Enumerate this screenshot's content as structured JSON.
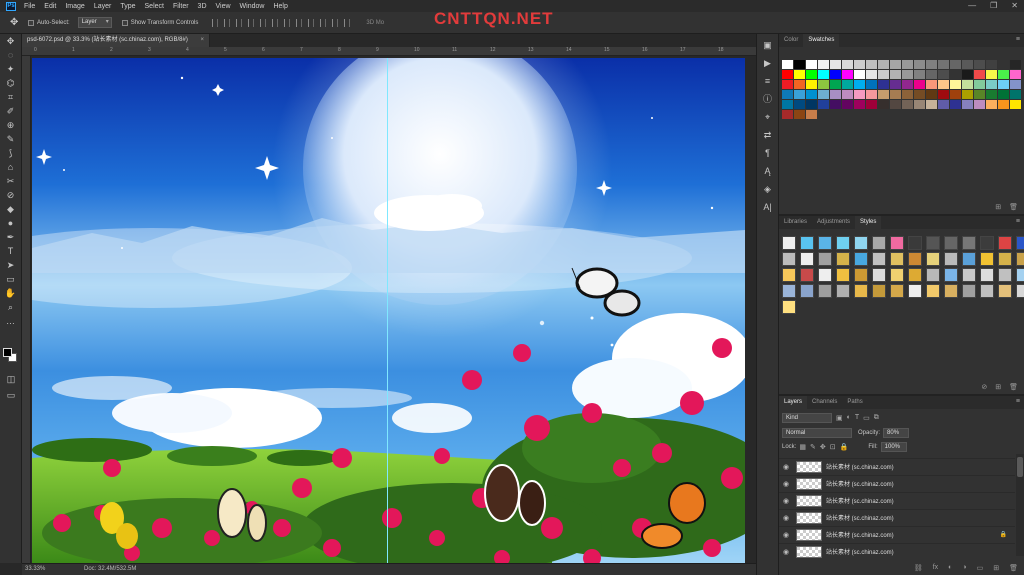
{
  "app": {
    "logo": "Ps"
  },
  "menu": [
    "File",
    "Edit",
    "Image",
    "Layer",
    "Type",
    "Select",
    "Filter",
    "3D",
    "View",
    "Window",
    "Help"
  ],
  "window_controls": [
    "—",
    "❐",
    "✕"
  ],
  "watermark": "CNTTQN.NET",
  "options": {
    "auto_select_label": "Auto-Select:",
    "auto_select_value": "Layer",
    "show_transform_label": "Show Transform Controls",
    "mode_3d": "3D Mo"
  },
  "document": {
    "tab_title": "psd-6072.psd @ 33.3% (站长素材 (sc.chinaz.com), RGB/8#)",
    "close": "×",
    "ruler_numbers": [
      "0",
      "1",
      "2",
      "3",
      "4",
      "5",
      "6",
      "7",
      "8",
      "9",
      "10",
      "11",
      "12",
      "13",
      "14",
      "15",
      "16",
      "17",
      "18"
    ]
  },
  "status": {
    "zoom": "33.33%",
    "doc": "Doc: 32.4M/532.5M"
  },
  "tools": [
    "✥",
    "◌",
    "✦",
    "⌬",
    "⌗",
    "✐",
    "⊕",
    "✎",
    "⟆",
    "⌂",
    "✂",
    "⊘",
    "◆",
    "●",
    "✒",
    "T",
    "➤",
    "▭",
    "✋",
    "⌕",
    "…"
  ],
  "dock_icons": [
    "▣",
    "▶",
    "≡",
    "ⓘ",
    "⌖",
    "⇄",
    "¶",
    "Ą",
    "◈",
    "A|"
  ],
  "color_panel": {
    "tabs": [
      "Color",
      "Swatches"
    ],
    "active_tab": "Swatches",
    "swatches": [
      "#ffffff",
      "#000000",
      "#ffffff",
      "#f2f2f2",
      "#e6e6e6",
      "#d9d9d9",
      "#cccccc",
      "#bfbfbf",
      "#b3b3b3",
      "#a6a6a6",
      "#999999",
      "#8c8c8c",
      "#808080",
      "#737373",
      "#666666",
      "#595959",
      "#4d4d4d",
      "#404040",
      "#333333",
      "#262626",
      "#ff0000",
      "#ffff00",
      "#00ff00",
      "#00ffff",
      "#0000ff",
      "#ff00ff",
      "#ffffff",
      "#e6e6e6",
      "#cccccc",
      "#b3b3b3",
      "#999999",
      "#808080",
      "#666666",
      "#4d4d4d",
      "#333333",
      "#1a1a1a",
      "#f04a4a",
      "#f7f74a",
      "#4af04a",
      "#ff66cc",
      "#ed1c24",
      "#f26522",
      "#fff200",
      "#8dc63f",
      "#00a651",
      "#00a99d",
      "#00aeef",
      "#0072bc",
      "#2e3192",
      "#662d91",
      "#92278f",
      "#ec008c",
      "#f7977a",
      "#fdc689",
      "#fff799",
      "#c4df9b",
      "#82ca9c",
      "#7accc8",
      "#6dcff6",
      "#8393ca",
      "#0e7ab8",
      "#3aa1d8",
      "#0091d0",
      "#6dafd0",
      "#a78ec3",
      "#bd8cbf",
      "#f49ac1",
      "#f5989d",
      "#c69c6d",
      "#a67c52",
      "#8c6239",
      "#754c24",
      "#603913",
      "#9e0b0f",
      "#a0410d",
      "#aba000",
      "#598527",
      "#197b30",
      "#007236",
      "#00746b",
      "#0076a3",
      "#004a80",
      "#003663",
      "#21409a",
      "#440e62",
      "#630460",
      "#9e005d",
      "#9e0039",
      "#362f2d",
      "#534741",
      "#736357",
      "#998675",
      "#c7b299",
      "#605ca8",
      "#2e3192",
      "#8781bd",
      "#bd8cbf",
      "#fbaf5d",
      "#f7941d",
      "#ffe600",
      "#a52a2a",
      "#8b4513",
      "#c77d4a"
    ]
  },
  "styles_panel": {
    "tabs": [
      "Libraries",
      "Adjustments",
      "Styles"
    ],
    "active_tab": "Styles",
    "styles": [
      "#eee",
      "#59c3f0",
      "#5ab4e8",
      "#6fd0f0",
      "#8fd5ef",
      "#a8a8a8",
      "#f06aa0",
      "#3a3a3a",
      "#555",
      "#666",
      "#777",
      "#3c3c3c",
      "#d44",
      "#2a56c8",
      "#bbb",
      "#eee",
      "#a0a0a0",
      "#d4b24a",
      "#48a8e0",
      "#c0c0c0",
      "#e0c060",
      "#cc8833",
      "#e6d17a",
      "#b9b9b9",
      "#5aa0d8",
      "#f1c232",
      "#d4b14a",
      "#c9a24a",
      "#f6c75a",
      "#c84a4a",
      "#eee",
      "#f0c040",
      "#cc9933",
      "#ddd",
      "#f0d070",
      "#ddaa33",
      "#b8b8b8",
      "#7ab4e8",
      "#c8c8c8",
      "#ddd",
      "#c0c0c0",
      "#a4d1f0",
      "#9ab4d8",
      "#8aa4cc",
      "#9e9e9e",
      "#b0b0b0",
      "#e8b84a",
      "#c49a3a",
      "#d4a84a",
      "#eee",
      "#f2c96a",
      "#d8b060",
      "#a0a0a0",
      "#c0c0c0",
      "#e4c07a",
      "#d8d8d8",
      "#ffe080"
    ]
  },
  "layers_panel": {
    "tabs": [
      "Layers",
      "Channels",
      "Paths"
    ],
    "active_tab": "Layers",
    "filter_label": "Kind",
    "blend_mode": "Normal",
    "opacity_label": "Opacity:",
    "opacity_value": "80%",
    "lock_label": "Lock:",
    "fill_label": "Fill:",
    "fill_value": "100%",
    "layers": [
      {
        "name": "站长素材 (sc.chinaz.com)",
        "locked": false
      },
      {
        "name": "站长素材 (sc.chinaz.com)",
        "locked": false
      },
      {
        "name": "站长素材 (sc.chinaz.com)",
        "locked": false
      },
      {
        "name": "站长素材 (sc.chinaz.com)",
        "locked": false
      },
      {
        "name": "站长素材 (sc.chinaz.com)",
        "locked": true
      },
      {
        "name": "站长素材 (sc.chinaz.com)",
        "locked": false
      }
    ],
    "footer_icons": [
      "⛓",
      "fx",
      "◐",
      "◑",
      "▭",
      "⊞",
      "🗑"
    ]
  }
}
